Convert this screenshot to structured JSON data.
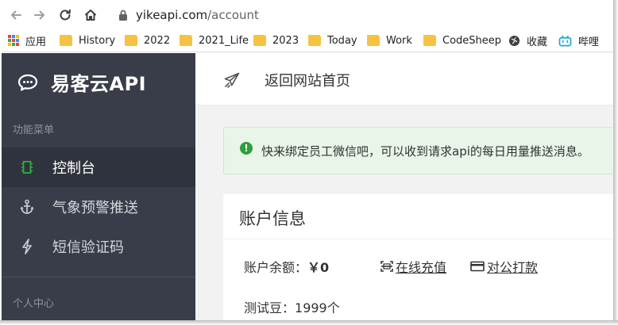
{
  "browser": {
    "url_host": "yikeapi.com",
    "url_path": "/account",
    "bookmarks": [
      {
        "label": "应用",
        "icon": "apps-icon"
      },
      {
        "label": "History",
        "icon": "folder-icon"
      },
      {
        "label": "2022",
        "icon": "folder-icon"
      },
      {
        "label": "2021_Life",
        "icon": "folder-icon"
      },
      {
        "label": "2023",
        "icon": "folder-icon"
      },
      {
        "label": "Today",
        "icon": "folder-icon"
      },
      {
        "label": "Work",
        "icon": "folder-icon"
      },
      {
        "label": "CodeSheep",
        "icon": "folder-icon"
      },
      {
        "label": "收藏",
        "icon": "globe-icon"
      },
      {
        "label": "哔哩",
        "icon": "bilibili-icon"
      }
    ]
  },
  "sidebar": {
    "brand": "易客云API",
    "group_function": "功能菜单",
    "group_personal": "个人中心",
    "items": [
      {
        "label": "控制台",
        "icon": "console-icon",
        "active": true
      },
      {
        "label": "气象预警推送",
        "icon": "anchor-icon",
        "active": false
      },
      {
        "label": "短信验证码",
        "icon": "bolt-icon",
        "active": false
      }
    ]
  },
  "topbar": {
    "home_link": "返回网站首页"
  },
  "alert": {
    "text": "快来绑定员工微信吧，可以收到请求api的每日用量推送消息。"
  },
  "account": {
    "title": "账户信息",
    "balance_label": "账户余额：",
    "balance_value": "￥0",
    "online_recharge": "在线充值",
    "bank_transfer": "对公打款",
    "beans_label": "测试豆：",
    "beans_value": "1999个"
  },
  "colors": {
    "sidebar_bg": "#393d49",
    "sidebar_active": "#2f333d",
    "alert_bg": "#e8f5e8",
    "alert_icon": "#2e9f3a",
    "console_icon": "#2fb13e"
  }
}
